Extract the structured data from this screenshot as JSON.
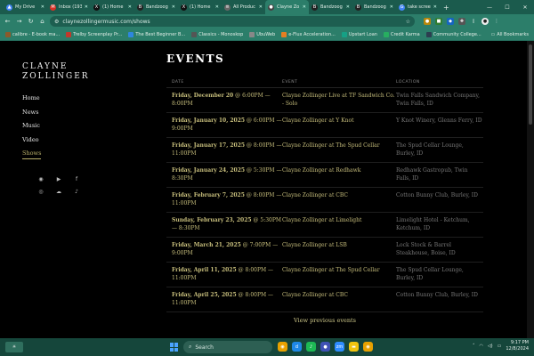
{
  "browser": {
    "tabs": [
      {
        "label": "My Drive",
        "color": "#4285f4",
        "glyph": "▲"
      },
      {
        "label": "Inbox (193",
        "color": "#d93025",
        "glyph": "M"
      },
      {
        "label": "(1) Home",
        "color": "#111111",
        "glyph": "X"
      },
      {
        "label": "Bandzoog",
        "color": "#222222",
        "glyph": "B"
      },
      {
        "label": "(1) Home",
        "color": "#111111",
        "glyph": "X"
      },
      {
        "label": "All Produc",
        "color": "#666666",
        "glyph": "≡"
      },
      {
        "label": "Clayne Zo",
        "color": "#444444",
        "glyph": "●",
        "active": true
      },
      {
        "label": "Bandzoog",
        "color": "#222222",
        "glyph": "B"
      },
      {
        "label": "Bandzoog",
        "color": "#222222",
        "glyph": "B"
      },
      {
        "label": "take scree",
        "color": "#4285f4",
        "glyph": "G"
      }
    ],
    "url": "claynezollingermusic.com/shows",
    "bookmarks": [
      {
        "label": "calibre - E-book ma...",
        "color": "#8b5a2b"
      },
      {
        "label": "Trelby Screenplay Pr...",
        "color": "#c0392b"
      },
      {
        "label": "The Best Beginner B...",
        "color": "#2e86de"
      },
      {
        "label": "Classics - Monoskop",
        "color": "#555555"
      },
      {
        "label": "UbuWeb",
        "color": "#888888"
      },
      {
        "label": "e-Flux Acceleration...",
        "color": "#e67e22"
      },
      {
        "label": "Upstart Loan",
        "color": "#16a085"
      },
      {
        "label": "Credit Karma",
        "color": "#27ae60"
      },
      {
        "label": "Community College...",
        "color": "#2c3e50"
      }
    ],
    "all_bookmarks": "All Bookmarks"
  },
  "site": {
    "logo_line1": "CLAYNE",
    "logo_line2": "ZOLLINGER",
    "nav": [
      {
        "label": "Home"
      },
      {
        "label": "News"
      },
      {
        "label": "Music"
      },
      {
        "label": "Video"
      },
      {
        "label": "Shows",
        "current": true
      }
    ]
  },
  "events": {
    "heading": "EVENTS",
    "columns": {
      "date": "DATE",
      "event": "EVENT",
      "location": "LOCATION"
    },
    "rows": [
      {
        "date": "Friday, December 20",
        "time": "@ 6:00PM — 8:00PM",
        "event": "Clayne Zollinger Live at TF Sandwich Co. - Solo",
        "location": "Twin Falls Sandwich Company, Twin Falls, ID"
      },
      {
        "date": "Friday, January 10, 2025",
        "time": "@ 6:00PM — 9:00PM",
        "event": "Clayne Zollinger at Y Knot",
        "location": "Y Knot Winery, Glenns Ferry, ID"
      },
      {
        "date": "Friday, January 17, 2025",
        "time": "@ 8:00PM — 11:00PM",
        "event": "Clayne Zollinger at The Spud Cellar",
        "location": "The Spud Cellar Lounge, Burley, ID"
      },
      {
        "date": "Friday, January 24, 2025",
        "time": "@ 5:30PM — 8:30PM",
        "event": "Clayne Zollinger at Redhawk",
        "location": "Redhawk Gastropub, Twin Falls, ID"
      },
      {
        "date": "Friday, February 7, 2025",
        "time": "@ 8:00PM — 11:00PM",
        "event": "Clayne Zollinger at CBC",
        "location": "Cotton Bunny Club, Burley, ID"
      },
      {
        "date": "Sunday, February 23, 2025",
        "time": "@ 5:30PM — 8:30PM",
        "event": "Clayne Zollinger at Limelight",
        "location": "Limelight Hotel - Ketchum, Ketchum, ID"
      },
      {
        "date": "Friday, March 21, 2025",
        "time": "@ 7:00PM — 9:00PM",
        "event": "Clayne Zollinger at LSB",
        "location": "Lock Stock & Barrel Steakhouse, Boise, ID"
      },
      {
        "date": "Friday, April 11, 2025",
        "time": "@ 8:00PM — 11:00PM",
        "event": "Clayne Zollinger at The Spud Cellar",
        "location": "The Spud Cellar Lounge, Burley, ID"
      },
      {
        "date": "Friday, April 25, 2025",
        "time": "@ 8:00PM — 11:00PM",
        "event": "Clayne Zollinger at CBC",
        "location": "Cotton Bunny Club, Burley, ID"
      }
    ],
    "view_previous": "View previous events"
  },
  "taskbar": {
    "search_placeholder": "Search",
    "time": "9:17 PM",
    "date": "12/8/2024",
    "apps": [
      {
        "name": "chrome",
        "color": "#e8a100",
        "glyph": "◉"
      },
      {
        "name": "d-app",
        "color": "#1e88e5",
        "glyph": "d"
      },
      {
        "name": "spotify",
        "color": "#1db954",
        "glyph": "♪"
      },
      {
        "name": "browser-2",
        "color": "#3f51b5",
        "glyph": "●"
      },
      {
        "name": "zoom",
        "color": "#2d8cff",
        "glyph": "zm"
      },
      {
        "name": "folder",
        "color": "#f1c40f",
        "glyph": "▬"
      },
      {
        "name": "chrome-2",
        "color": "#e8a100",
        "glyph": "◉"
      }
    ]
  }
}
